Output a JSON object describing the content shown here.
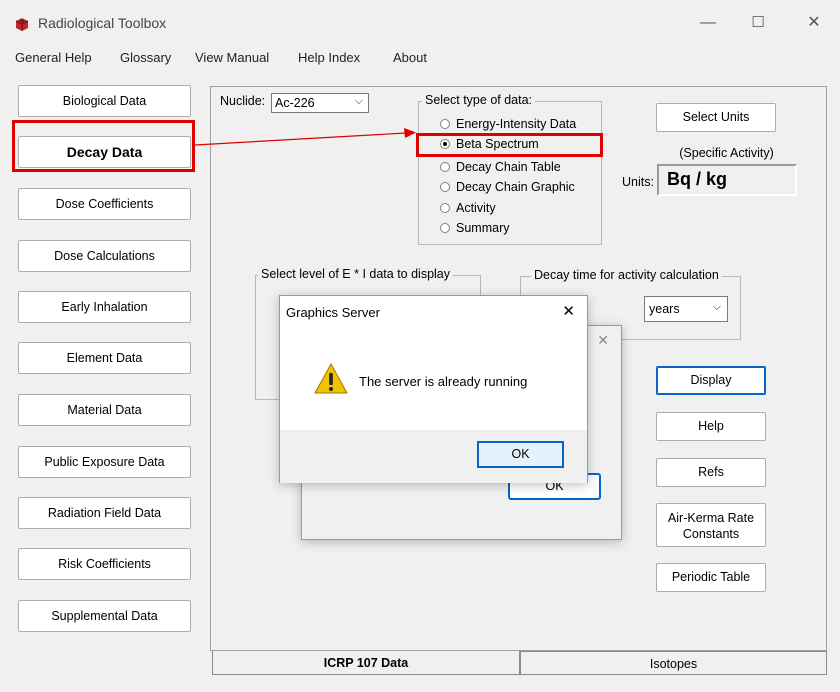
{
  "window": {
    "title": "Radiological Toolbox",
    "minimize_glyph": "—",
    "maximize_glyph": "☐",
    "close_glyph": "✕"
  },
  "menu": [
    "General Help",
    "Glossary",
    "View Manual",
    "Help Index",
    "About"
  ],
  "left_buttons": [
    "Biological Data",
    "Decay Data",
    "Dose Coefficients",
    "Dose Calculations",
    "Early Inhalation",
    "Element Data",
    "Material Data",
    "Public Exposure Data",
    "Radiation Field Data",
    "Risk Coefficients",
    "Supplemental Data"
  ],
  "nuclide": {
    "label": "Nuclide:",
    "value": "Ac-226"
  },
  "data_type": {
    "label": "Select type of data:",
    "options": [
      {
        "label": "Energy-Intensity Data",
        "selected": false
      },
      {
        "label": "Beta Spectrum",
        "selected": true
      },
      {
        "label": "Decay Chain Table",
        "selected": false
      },
      {
        "label": "Decay Chain Graphic",
        "selected": false
      },
      {
        "label": "Activity",
        "selected": false
      },
      {
        "label": "Summary",
        "selected": false
      }
    ]
  },
  "units": {
    "select_button": "Select Units",
    "subtitle": "(Specific Activity)",
    "label": "Units:",
    "value": "Bq / kg"
  },
  "level_group": {
    "label": "Select level of E * I data to display"
  },
  "decay_time": {
    "label": "Decay time for activity calculation",
    "unit": "years"
  },
  "right_buttons": {
    "display": "Display",
    "help": "Help",
    "refs": "Refs",
    "air_kerma_line1": "Air-Kerma Rate",
    "air_kerma_line2": "Constants",
    "periodic_table": "Periodic Table"
  },
  "tabs": [
    "ICRP 107 Data",
    "Isotopes"
  ],
  "background_dialog": {
    "ok": "OK",
    "close_glyph": "✕"
  },
  "dialog": {
    "title": "Graphics Server",
    "message": "The server is already running",
    "ok": "OK",
    "close_glyph": "✕"
  },
  "colors": {
    "highlight": "#e00000",
    "warning_icon": "#f2c200",
    "focus_blue": "#0a64c8"
  }
}
